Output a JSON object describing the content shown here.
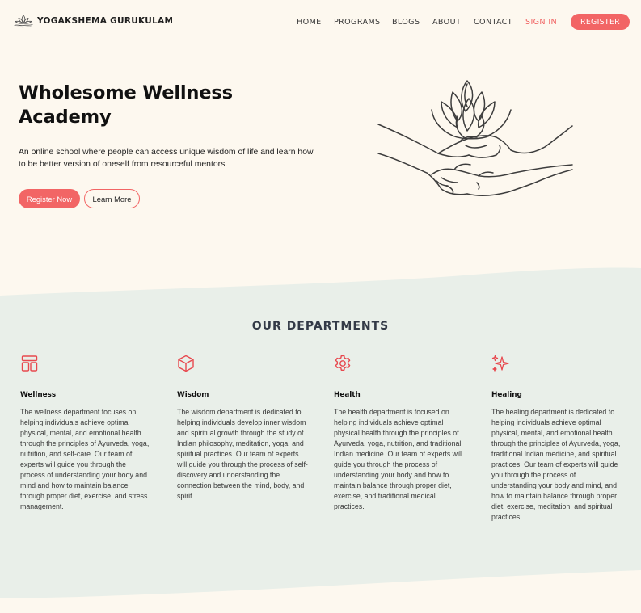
{
  "brand": {
    "name": "YOGAKSHEMA GURUKULAM",
    "logo_icon": "lotus-logo-icon"
  },
  "nav": {
    "links": [
      "HOME",
      "PROGRAMS",
      "BLOGS",
      "ABOUT",
      "CONTACT"
    ],
    "signin": "SIGN IN",
    "register": "REGISTER"
  },
  "hero": {
    "title": "Wholesome Wellness Academy",
    "description": "An online school where people can access unique wisdom of life and learn how to be better version of oneself from resourceful mentors.",
    "primary_button": "Register Now",
    "secondary_button": "Learn More",
    "illustration_icon": "hands-holding-lotus-illustration"
  },
  "departments": {
    "title": "OUR DEPARTMENTS",
    "items": [
      {
        "name": "Wellness",
        "icon": "layout-icon",
        "text": "The wellness department focuses on helping individuals achieve optimal physical, mental, and emotional health through the principles of Ayurveda, yoga, nutrition, and self-care. Our team of experts will guide you through the process of understanding your body and mind and how to maintain balance through proper diet, exercise, and stress management."
      },
      {
        "name": "Wisdom",
        "icon": "cube-icon",
        "text": "The wisdom department is dedicated to helping individuals develop inner wisdom and spiritual growth through the study of Indian philosophy, meditation, yoga, and spiritual practices. Our team of experts will guide you through the process of self-discovery and understanding the connection between the mind, body, and spirit."
      },
      {
        "name": "Health",
        "icon": "gear-icon",
        "text": "The health department is focused on helping individuals achieve optimal physical health through the principles of Ayurveda, yoga, nutrition, and traditional Indian medicine. Our team of experts will guide you through the process of understanding your body and how to maintain balance through proper diet, exercise, and traditional medical practices."
      },
      {
        "name": "Healing",
        "icon": "sparkles-icon",
        "text": "The healing department is dedicated to helping individuals achieve optimal physical, mental, and emotional health through the principles of Ayurveda, yoga, traditional Indian medicine, and spiritual practices. Our team of experts will guide you through the process of understanding your body and mind, and how to maintain balance through proper diet, exercise, meditation, and spiritual practices."
      }
    ]
  },
  "colors": {
    "accent": "#f26565",
    "page_background": "#fdf8ef",
    "section_background": "#e9efe9",
    "heading": "#333a47"
  }
}
